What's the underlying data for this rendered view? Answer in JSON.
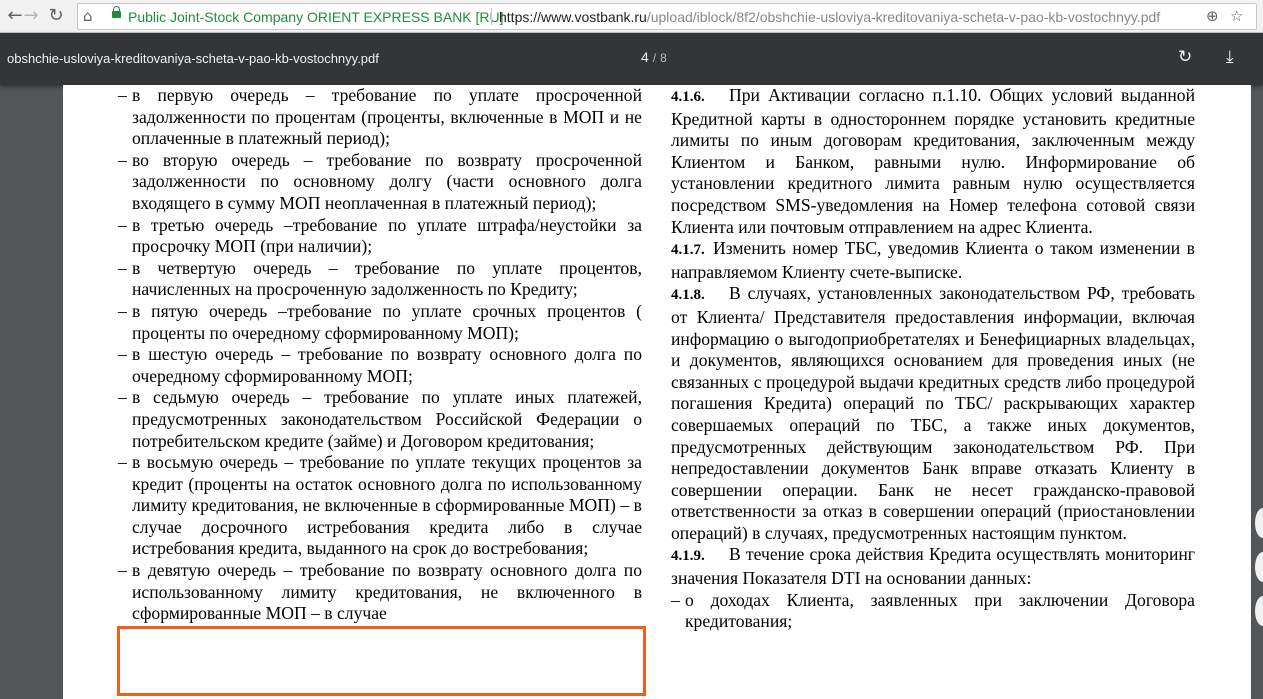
{
  "browser": {
    "nav": {
      "back_icon": "arrow-left-icon",
      "forward_icon": "arrow-right-icon",
      "reload_icon": "reload-icon",
      "home_icon": "home-icon"
    },
    "site_name": "Public Joint-Stock Company ORIENT EXPRESS BANK [RU]",
    "url_host": "https://www.vostbank.ru",
    "url_path": "/upload/iblock/8f2/obshchie-usloviya-kreditovaniya-scheta-v-pao-kb-vostochnyy.pdf",
    "zoom_icon": "zoom-icon",
    "bookmark_icon": "star-icon"
  },
  "pdf": {
    "title": "obshchie-usloviya-kreditovaniya-scheta-v-pao-kb-vostochnyy.pdf",
    "page_current": "4",
    "page_sep": "/",
    "page_total": "8"
  },
  "left_column": [
    "в первую очередь – требование по уплате просроченной задолженности по процентам (проценты, включенные в МОП и не оплаченные в платежный период);",
    "во вторую очередь – требование по возврату просроченной задолженности по основному долгу (части основного долга входящего в сумму МОП неоплаченная в платежный период);",
    "в третью очередь –требование по уплате штрафа/неустойки за просрочку МОП (при наличии);",
    "в четвертую очередь – требование по уплате процентов, начисленных на просроченную задолженность по Кредиту;",
    "в пятую очередь –требование по уплате срочных процентов ( проценты по очередному сформированному МОП);",
    "в шестую очередь – требование по возврату основного долга по очередному сформированному МОП;",
    "в седьмую очередь – требование по уплате иных платежей, предусмотренных законодательством Российской Федерации о потребительском кредите (займе) и Договором кредитования;",
    "в восьмую очередь – требование по уплате текущих процентов за кредит (проценты на остаток основного долга по использованному лимиту кредитования, не включенные в сформированные МОП) – в случае досрочного истребования кредита либо в случае истребования кредита, выданного на срок до востребования;",
    "в девятую очередь – требование по возврату основного долга по использованному лимиту кредитования, не включенного в сформированные МОП – в случае"
  ],
  "right_column": {
    "s416": {
      "num": "4.1.6.",
      "text": "При Активации согласно п.1.10. Общих условий выданной Кредитной карты в одностороннем порядке установить кредитные лимиты по иным договорам кредитования, заключенным между Клиентом и Банком, равными нулю. Информирование об установлении кредитного лимита равным нулю осуществляется посредством SMS-уведомления на Номер телефона сотовой связи Клиента или почтовым отправлением на адрес Клиента."
    },
    "s417": {
      "num": "4.1.7.",
      "text": "Изменить номер ТБС, уведомив Клиента о таком изменении в направляемом Клиенту счете-выписке."
    },
    "s418": {
      "num": "4.1.8.",
      "text": "В случаях, установленных законодательством РФ, требовать от Клиента/ Представителя предоставления информации, включая информацию о выгодоприобретателях и Бенефициарных владельцах, и документов, являющихся основанием для проведения иных (не связанных с процедурой выдачи кредитных средств либо процедурой погашения Кредита) операций по ТБС/ раскрывающих характер совершаемых операций по ТБС, а также иных документов, предусмотренных действующим законодательством РФ. При непредоставлении документов Банк вправе отказать Клиенту в совершении операции. Банк не несет гражданско-правовой ответственности за отказ в совершении операций (приостановлении операций) в случаях, предусмотренных настоящим пунктом."
    },
    "s419": {
      "num": "4.1.9.",
      "text": "В течение срока действия Кредита осуществлять мониторинг значения Показателя DTI на основании данных:"
    },
    "s419_item": "о доходах Клиента, заявленных при заключении Договора кредитования;"
  },
  "highlight_color": "#e8621c"
}
